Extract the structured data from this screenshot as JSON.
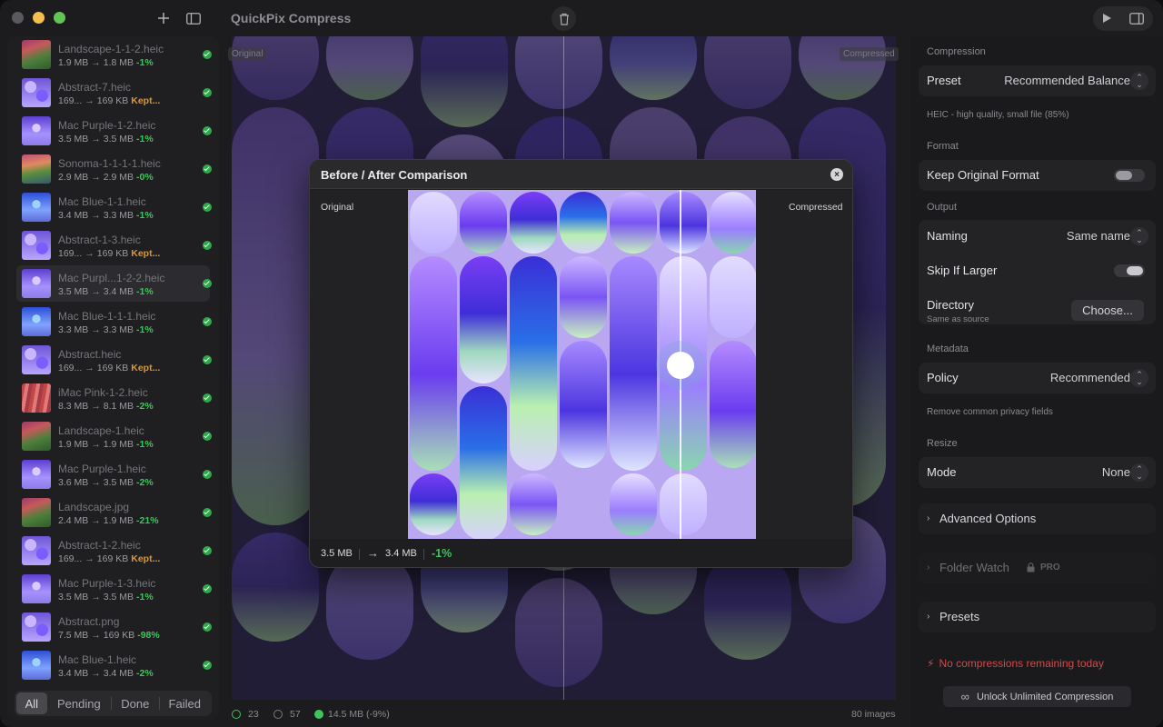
{
  "app": {
    "title": "QuickPix Compress"
  },
  "files": [
    {
      "name": "Landscape-1-1-2.heic",
      "from": "1.9 MB",
      "to": "1.8 MB",
      "change": "-1%",
      "status": "green",
      "thumb": "landscape"
    },
    {
      "name": "Abstract-7.heic",
      "from": "169...",
      "to": "169 KB",
      "change": "Kept...",
      "status": "orange",
      "thumb": "abstract"
    },
    {
      "name": "Mac Purple-1-2.heic",
      "from": "3.5 MB",
      "to": "3.5 MB",
      "change": "-1%",
      "status": "green",
      "thumb": "purple"
    },
    {
      "name": "Sonoma-1-1-1-1.heic",
      "from": "2.9 MB",
      "to": "2.9 MB",
      "change": "-0%",
      "status": "green",
      "thumb": "sonoma"
    },
    {
      "name": "Mac Blue-1-1.heic",
      "from": "3.4 MB",
      "to": "3.3 MB",
      "change": "-1%",
      "status": "green",
      "thumb": "blue"
    },
    {
      "name": "Abstract-1-3.heic",
      "from": "169...",
      "to": "169 KB",
      "change": "Kept...",
      "status": "orange",
      "thumb": "abstract"
    },
    {
      "name": "Mac Purpl...1-2-2.heic",
      "from": "3.5 MB",
      "to": "3.4 MB",
      "change": "-1%",
      "status": "green",
      "thumb": "purple",
      "selected": true
    },
    {
      "name": "Mac Blue-1-1-1.heic",
      "from": "3.3 MB",
      "to": "3.3 MB",
      "change": "-1%",
      "status": "green",
      "thumb": "blue"
    },
    {
      "name": "Abstract.heic",
      "from": "169...",
      "to": "169 KB",
      "change": "Kept...",
      "status": "orange",
      "thumb": "abstract"
    },
    {
      "name": "iMac Pink-1-2.heic",
      "from": "8.3 MB",
      "to": "8.1 MB",
      "change": "-2%",
      "status": "green",
      "thumb": "pink"
    },
    {
      "name": "Landscape-1.heic",
      "from": "1.9 MB",
      "to": "1.9 MB",
      "change": "-1%",
      "status": "green",
      "thumb": "landscape"
    },
    {
      "name": "Mac Purple-1.heic",
      "from": "3.6 MB",
      "to": "3.5 MB",
      "change": "-2%",
      "status": "green",
      "thumb": "purple"
    },
    {
      "name": "Landscape.jpg",
      "from": "2.4 MB",
      "to": "1.9 MB",
      "change": "-21%",
      "status": "green",
      "thumb": "landscape"
    },
    {
      "name": "Abstract-1-2.heic",
      "from": "169...",
      "to": "169 KB",
      "change": "Kept...",
      "status": "orange",
      "thumb": "abstract"
    },
    {
      "name": "Mac Purple-1-3.heic",
      "from": "3.5 MB",
      "to": "3.5 MB",
      "change": "-1%",
      "status": "green",
      "thumb": "purple"
    },
    {
      "name": "Abstract.png",
      "from": "7.5 MB",
      "to": "169 KB",
      "change": "-98%",
      "status": "green",
      "thumb": "abstract"
    },
    {
      "name": "Mac Blue-1.heic",
      "from": "3.4 MB",
      "to": "3.4 MB",
      "change": "-2%",
      "status": "green",
      "thumb": "blue"
    }
  ],
  "filters": [
    "All",
    "Pending",
    "Done",
    "Failed"
  ],
  "preview": {
    "original_label": "Original",
    "compressed_label": "Compressed"
  },
  "status": {
    "done_count": "23",
    "pending_count": "57",
    "saved": "14.5 MB (-9%)",
    "total": "80 images"
  },
  "modal": {
    "title": "Before / After Comparison",
    "original_label": "Original",
    "compressed_label": "Compressed",
    "from": "3.5 MB",
    "to": "3.4 MB",
    "change": "-1%"
  },
  "settings": {
    "compression": {
      "section": "Compression",
      "preset_label": "Preset",
      "preset_value": "Recommended Balance",
      "hint": "HEIC - high quality, small file (85%)"
    },
    "format": {
      "section": "Format",
      "keep_label": "Keep Original Format"
    },
    "output": {
      "section": "Output",
      "naming_label": "Naming",
      "naming_value": "Same name",
      "skip_label": "Skip If Larger",
      "directory_label": "Directory",
      "directory_sub": "Same as source",
      "choose_label": "Choose..."
    },
    "metadata": {
      "section": "Metadata",
      "policy_label": "Policy",
      "policy_value": "Recommended",
      "hint": "Remove common privacy fields"
    },
    "resize": {
      "section": "Resize",
      "mode_label": "Mode",
      "mode_value": "None"
    },
    "advanced_label": "Advanced Options",
    "folder_watch_label": "Folder Watch",
    "pro_badge": "PRO",
    "presets_label": "Presets",
    "warning": "No compressions remaining today",
    "unlock_label": "Unlock Unlimited Compression"
  },
  "colors": {
    "accent_green": "#3fc45a",
    "kept_orange": "#e0962f",
    "warning_red": "#d04a4a"
  }
}
